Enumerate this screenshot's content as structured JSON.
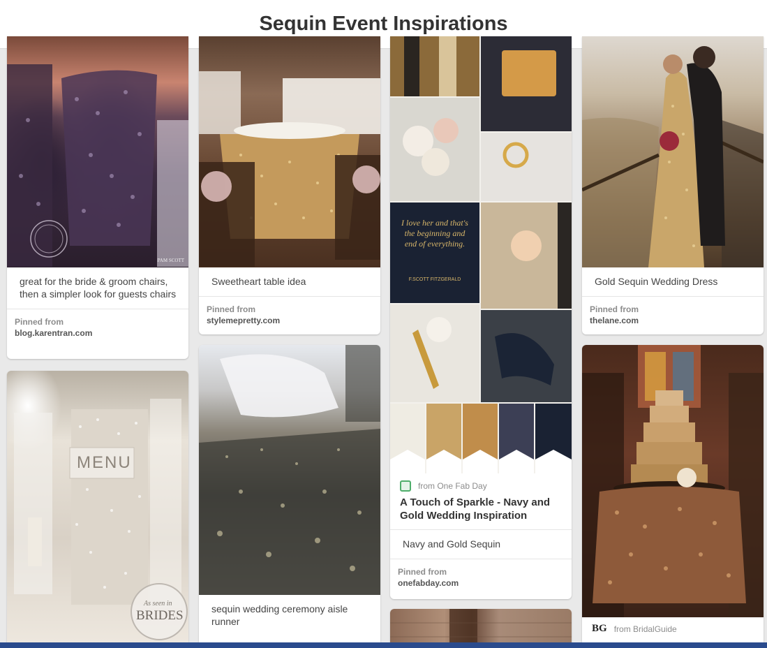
{
  "header": {
    "title": "Sequin Event Inspirations"
  },
  "pins": {
    "p1": {
      "description": "great for the bride & groom chairs, then a simpler look for guests chairs",
      "pinned_label": "Pinned from",
      "source": "blog.karentran.com",
      "watermark": "PAM SCOTT"
    },
    "p2": {
      "description": "Sweetheart table idea",
      "pinned_label": "Pinned from",
      "source": "stylemepretty.com"
    },
    "p3": {
      "from_text": "from One Fab Day",
      "rich_title": "A Touch of Sparkle - Navy and Gold Wedding Inspiration",
      "description": "Navy and Gold Sequin",
      "pinned_label": "Pinned from",
      "source": "onefabday.com",
      "collage_text": "I love her and that's the beginning and end of everything.",
      "collage_author": "F.SCOTT FITZGERALD",
      "swatches": [
        "#efece3",
        "#c9a467",
        "#c08d4b",
        "#3c3f55",
        "#1a2233"
      ]
    },
    "p4": {
      "description": "Gold Sequin Wedding Dress",
      "pinned_label": "Pinned from",
      "source": "thelane.com"
    },
    "p5": {
      "menu_text": "MENU",
      "badge_line1": "As seen in",
      "badge_line2": "BRIDES"
    },
    "p6": {
      "description": "sequin wedding ceremony aisle runner"
    },
    "p8": {
      "icon_text": "BG",
      "from_text": "from BridalGuide"
    }
  },
  "colors": {
    "accent_bar": "#2a4b8d",
    "onefab_icon": "#4fae6b"
  }
}
